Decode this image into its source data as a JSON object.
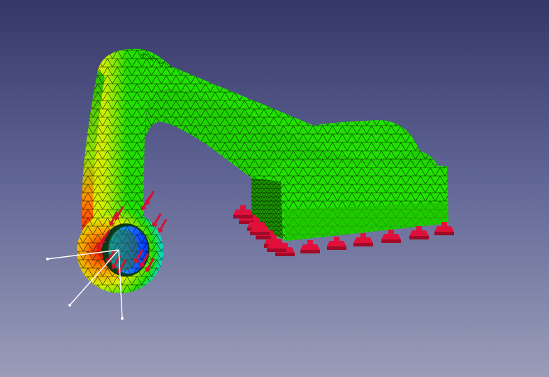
{
  "view": {
    "background_top": "#353766",
    "background_bottom": "#9a9db8"
  },
  "model": {
    "name": "fem-bracket-mesh",
    "mesh_color": "#000000",
    "result_colors": [
      "#0033ff",
      "#00d8ff",
      "#22e000",
      "#f2e600",
      "#ff6a00",
      "#e60000"
    ]
  },
  "constraints": {
    "fixed_color": "#e0103a",
    "force_color": "#d81030",
    "fixed_support_count": 14,
    "force_arrow_count": 14
  },
  "navigation_cube": {
    "axis_color": "#ffffff"
  }
}
